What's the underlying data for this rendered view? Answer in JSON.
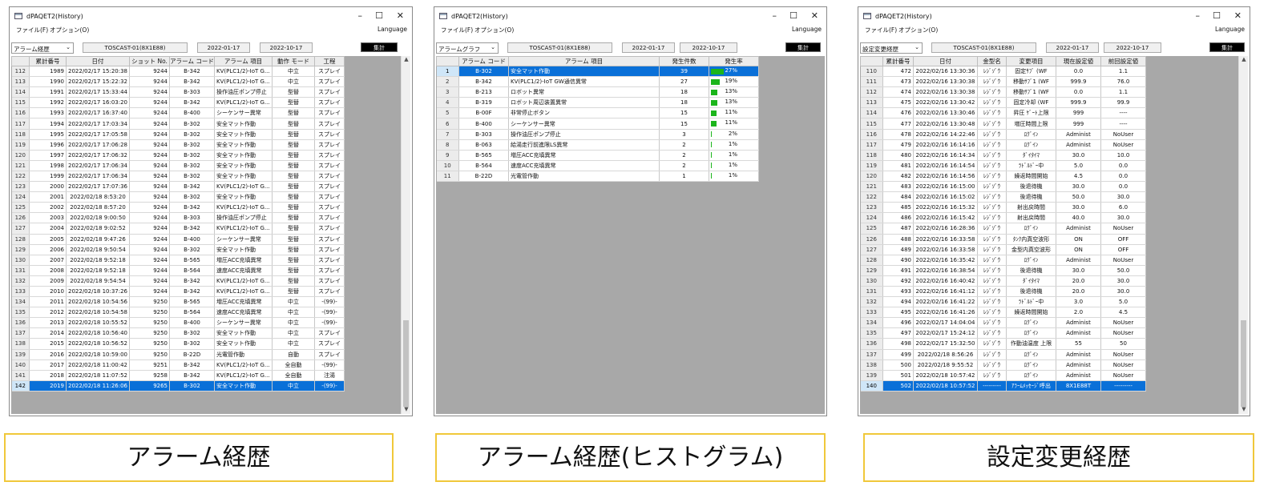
{
  "window_title": "dPAQET2(History)",
  "window_controls": {
    "min": "–",
    "max": "☐",
    "close": "✕"
  },
  "menu": {
    "file": "ファイル(F)",
    "option": "オプション(O)",
    "language": "Language"
  },
  "toolbar": {
    "machine": "TOSCAST-01(8X1E88)",
    "date_from": "2022-01-17",
    "date_to": "2022-10-17",
    "sum_button": "集計"
  },
  "panels": [
    {
      "combo": "アラーム経歴",
      "columns": [
        "累計番号",
        "日付",
        "ショット No.",
        "アラーム コード",
        "アラーム 項目",
        "動作 モード",
        "工程"
      ],
      "rows": [
        [
          "112",
          "1989",
          "2022/02/17 15:20:38",
          "9244",
          "B-342",
          "KV(PLC1/2)-IoT G...",
          "中立",
          "スプレイ"
        ],
        [
          "113",
          "1990",
          "2022/02/17 15:22:32",
          "9244",
          "B-342",
          "KV(PLC1/2)-IoT G...",
          "中立",
          "スプレイ"
        ],
        [
          "114",
          "1991",
          "2022/02/17 15:33:44",
          "9244",
          "B-303",
          "操作油圧ポンプ停止",
          "型替",
          "スプレイ"
        ],
        [
          "115",
          "1992",
          "2022/02/17 16:03:20",
          "9244",
          "B-342",
          "KV(PLC1/2)-IoT G...",
          "型替",
          "スプレイ"
        ],
        [
          "116",
          "1993",
          "2022/02/17 16:37:40",
          "9244",
          "B-400",
          "シーケンサー異常",
          "型替",
          "スプレイ"
        ],
        [
          "117",
          "1994",
          "2022/02/17 17:03:34",
          "9244",
          "B-302",
          "安全マット作動",
          "型替",
          "スプレイ"
        ],
        [
          "118",
          "1995",
          "2022/02/17 17:05:58",
          "9244",
          "B-302",
          "安全マット作動",
          "型替",
          "スプレイ"
        ],
        [
          "119",
          "1996",
          "2022/02/17 17:06:28",
          "9244",
          "B-302",
          "安全マット作動",
          "型替",
          "スプレイ"
        ],
        [
          "120",
          "1997",
          "2022/02/17 17:06:32",
          "9244",
          "B-302",
          "安全マット作動",
          "型替",
          "スプレイ"
        ],
        [
          "121",
          "1998",
          "2022/02/17 17:06:34",
          "9244",
          "B-302",
          "安全マット作動",
          "型替",
          "スプレイ"
        ],
        [
          "122",
          "1999",
          "2022/02/17 17:06:34",
          "9244",
          "B-302",
          "安全マット作動",
          "型替",
          "スプレイ"
        ],
        [
          "123",
          "2000",
          "2022/02/17 17:07:36",
          "9244",
          "B-342",
          "KV(PLC1/2)-IoT G...",
          "型替",
          "スプレイ"
        ],
        [
          "124",
          "2001",
          "2022/02/18 8:53:20",
          "9244",
          "B-302",
          "安全マット作動",
          "型替",
          "スプレイ"
        ],
        [
          "125",
          "2002",
          "2022/02/18 8:57:20",
          "9244",
          "B-342",
          "KV(PLC1/2)-IoT G...",
          "型替",
          "スプレイ"
        ],
        [
          "126",
          "2003",
          "2022/02/18 9:00:50",
          "9244",
          "B-303",
          "操作油圧ポンプ停止",
          "型替",
          "スプレイ"
        ],
        [
          "127",
          "2004",
          "2022/02/18 9:02:52",
          "9244",
          "B-342",
          "KV(PLC1/2)-IoT G...",
          "型替",
          "スプレイ"
        ],
        [
          "128",
          "2005",
          "2022/02/18 9:47:26",
          "9244",
          "B-400",
          "シーケンサー異常",
          "型替",
          "スプレイ"
        ],
        [
          "129",
          "2006",
          "2022/02/18 9:50:54",
          "9244",
          "B-302",
          "安全マット作動",
          "型替",
          "スプレイ"
        ],
        [
          "130",
          "2007",
          "2022/02/18 9:52:18",
          "9244",
          "B-565",
          "増圧ACC充填異常",
          "型替",
          "スプレイ"
        ],
        [
          "131",
          "2008",
          "2022/02/18 9:52:18",
          "9244",
          "B-564",
          "速度ACC充填異常",
          "型替",
          "スプレイ"
        ],
        [
          "132",
          "2009",
          "2022/02/18 9:54:54",
          "9244",
          "B-342",
          "KV(PLC1/2)-IoT G...",
          "型替",
          "スプレイ"
        ],
        [
          "133",
          "2010",
          "2022/02/18 10:37:26",
          "9244",
          "B-342",
          "KV(PLC1/2)-IoT G...",
          "型替",
          "スプレイ"
        ],
        [
          "134",
          "2011",
          "2022/02/18 10:54:56",
          "9250",
          "B-565",
          "増圧ACC充填異常",
          "中立",
          "-(99)-"
        ],
        [
          "135",
          "2012",
          "2022/02/18 10:54:58",
          "9250",
          "B-564",
          "速度ACC充填異常",
          "中立",
          "-(99)-"
        ],
        [
          "136",
          "2013",
          "2022/02/18 10:55:52",
          "9250",
          "B-400",
          "シーケンサー異常",
          "中立",
          "-(99)-"
        ],
        [
          "137",
          "2014",
          "2022/02/18 10:56:40",
          "9250",
          "B-302",
          "安全マット作動",
          "中立",
          "スプレイ"
        ],
        [
          "138",
          "2015",
          "2022/02/18 10:56:52",
          "9250",
          "B-302",
          "安全マット作動",
          "中立",
          "スプレイ"
        ],
        [
          "139",
          "2016",
          "2022/02/18 10:59:00",
          "9250",
          "B-22D",
          "光電管作動",
          "自動",
          "スプレイ"
        ],
        [
          "140",
          "2017",
          "2022/02/18 11:00:42",
          "9251",
          "B-342",
          "KV(PLC1/2)-IoT G...",
          "全自動",
          "-(99)-"
        ],
        [
          "141",
          "2018",
          "2022/02/18 11:07:52",
          "9258",
          "B-342",
          "KV(PLC1/2)-IoT G...",
          "全自動",
          "注湯"
        ],
        [
          "142",
          "2019",
          "2022/02/18 11:26:06",
          "9265",
          "B-302",
          "安全マット作動",
          "中立",
          "-(99)-"
        ]
      ]
    },
    {
      "combo": "アラームグラフ",
      "columns": [
        "アラーム コード",
        "アラーム 項目",
        "発生件数",
        "発生率"
      ],
      "rows": [
        [
          "1",
          "B-302",
          "安全マット作動",
          "39",
          "27%"
        ],
        [
          "2",
          "B-342",
          "KV(PLC1/2)-IoT GW通信異常",
          "27",
          "19%"
        ],
        [
          "3",
          "B-213",
          "ロボット異常",
          "18",
          "13%"
        ],
        [
          "4",
          "B-319",
          "ロボット周辺装置異常",
          "18",
          "13%"
        ],
        [
          "5",
          "B-00F",
          "非常停止ボタン",
          "15",
          "11%"
        ],
        [
          "6",
          "B-400",
          "シーケンサー異常",
          "15",
          "11%"
        ],
        [
          "7",
          "B-303",
          "操作油圧ポンプ停止",
          "3",
          "2%"
        ],
        [
          "8",
          "B-063",
          "給湯走行前進限LS異常",
          "2",
          "1%"
        ],
        [
          "9",
          "B-565",
          "増圧ACC充填異常",
          "2",
          "1%"
        ],
        [
          "10",
          "B-564",
          "速度ACC充填異常",
          "2",
          "1%"
        ],
        [
          "11",
          "B-22D",
          "光電管作動",
          "1",
          "1%"
        ]
      ],
      "rates": [
        0.27,
        0.19,
        0.13,
        0.13,
        0.11,
        0.11,
        0.02,
        0.01,
        0.01,
        0.01,
        0.01
      ]
    },
    {
      "combo": "設定変更経歴",
      "columns": [
        "累計番号",
        "日付",
        "金型名",
        "変更項目",
        "現在設定値",
        "前回設定値"
      ],
      "rows": [
        [
          "110",
          "472",
          "2022/02/16 13:30:36",
          "ﾚｼﾞｿﾞｳ",
          "固定ｻﾌﾞ (WF",
          "0.0",
          "1.1"
        ],
        [
          "111",
          "473",
          "2022/02/16 13:30:38",
          "ﾚｼﾞｿﾞｳ",
          "移動ｻﾌﾞ1 (WF",
          "999.9",
          "76.0"
        ],
        [
          "112",
          "474",
          "2022/02/16 13:30:38",
          "ﾚｼﾞｿﾞｳ",
          "移動ｻﾌﾞ1 (WF",
          "0.0",
          "1.1"
        ],
        [
          "113",
          "475",
          "2022/02/16 13:30:42",
          "ﾚｼﾞｿﾞｳ",
          "固定冷却 (WF",
          "999.9",
          "99.9"
        ],
        [
          "114",
          "476",
          "2022/02/16 13:30:46",
          "ﾚｼﾞｿﾞｳ",
          "昇圧 ｹﾞｰﾄ上限",
          "999",
          "----"
        ],
        [
          "115",
          "477",
          "2022/02/16 13:30:48",
          "ﾚｼﾞｿﾞｳ",
          "増圧時間上限",
          "999",
          "----"
        ],
        [
          "116",
          "478",
          "2022/02/16 14:22:46",
          "ﾚｼﾞｿﾞｳ",
          "ﾛｸﾞｲﾝ",
          "Administ",
          "NoUser"
        ],
        [
          "117",
          "479",
          "2022/02/16 16:14:16",
          "ﾚｼﾞｿﾞｳ",
          "ﾛｸﾞｲﾝ",
          "Administ",
          "NoUser"
        ],
        [
          "118",
          "480",
          "2022/02/16 16:14:34",
          "ﾚｼﾞｿﾞｳ",
          "ﾀﾞｲﾀｲﾏ",
          "30.0",
          "10.0"
        ],
        [
          "119",
          "481",
          "2022/02/16 16:14:54",
          "ﾚｼﾞｿﾞｳ",
          "ﾗﾄﾞﾙﾄﾞｰ中",
          "5.0",
          "0.0"
        ],
        [
          "120",
          "482",
          "2022/02/16 16:14:56",
          "ﾚｼﾞｿﾞｳ",
          "繰返時間開始",
          "4.5",
          "0.0"
        ],
        [
          "121",
          "483",
          "2022/02/16 16:15:00",
          "ﾚｼﾞｿﾞｳ",
          "後退待機",
          "30.0",
          "0.0"
        ],
        [
          "122",
          "484",
          "2022/02/16 16:15:02",
          "ﾚｼﾞｿﾞｳ",
          "後退待機",
          "50.0",
          "30.0"
        ],
        [
          "123",
          "485",
          "2022/02/16 16:15:32",
          "ﾚｼﾞｿﾞｳ",
          "射出戻時間",
          "30.0",
          "6.0"
        ],
        [
          "124",
          "486",
          "2022/02/16 16:15:42",
          "ﾚｼﾞｿﾞｳ",
          "射出戻時間",
          "40.0",
          "30.0"
        ],
        [
          "125",
          "487",
          "2022/02/16 16:28:36",
          "ﾚｼﾞｿﾞｳ",
          "ﾛｸﾞｲﾝ",
          "Administ",
          "NoUser"
        ],
        [
          "126",
          "488",
          "2022/02/16 16:33:58",
          "ﾚｼﾞｿﾞｳ",
          "ﾀﾝｸ内真空波形",
          "ON",
          "OFF"
        ],
        [
          "127",
          "489",
          "2022/02/16 16:33:58",
          "ﾚｼﾞｿﾞｳ",
          "金型内真空波形",
          "ON",
          "OFF"
        ],
        [
          "128",
          "490",
          "2022/02/16 16:35:42",
          "ﾚｼﾞｿﾞｳ",
          "ﾛｸﾞｲﾝ",
          "Administ",
          "NoUser"
        ],
        [
          "129",
          "491",
          "2022/02/16 16:38:54",
          "ﾚｼﾞｿﾞｳ",
          "後退待機",
          "30.0",
          "50.0"
        ],
        [
          "130",
          "492",
          "2022/02/16 16:40:42",
          "ﾚｼﾞｿﾞｳ",
          "ﾀﾞｲﾀｲﾏ",
          "20.0",
          "30.0"
        ],
        [
          "131",
          "493",
          "2022/02/16 16:41:12",
          "ﾚｼﾞｿﾞｳ",
          "後退待機",
          "20.0",
          "30.0"
        ],
        [
          "132",
          "494",
          "2022/02/16 16:41:22",
          "ﾚｼﾞｿﾞｳ",
          "ﾗﾄﾞﾙﾄﾞｰ中",
          "3.0",
          "5.0"
        ],
        [
          "133",
          "495",
          "2022/02/16 16:41:26",
          "ﾚｼﾞｿﾞｳ",
          "繰返時間開始",
          "2.0",
          "4.5"
        ],
        [
          "134",
          "496",
          "2022/02/17 14:04:04",
          "ﾚｼﾞｿﾞｳ",
          "ﾛｸﾞｲﾝ",
          "Administ",
          "NoUser"
        ],
        [
          "135",
          "497",
          "2022/02/17 15:24:12",
          "ﾚｼﾞｿﾞｳ",
          "ﾛｸﾞｲﾝ",
          "Administ",
          "NoUser"
        ],
        [
          "136",
          "498",
          "2022/02/17 15:32:50",
          "ﾚｼﾞｿﾞｳ",
          "作動油温度 上限",
          "55",
          "50"
        ],
        [
          "137",
          "499",
          "2022/02/18 8:56:26",
          "ﾚｼﾞｿﾞｳ",
          "ﾛｸﾞｲﾝ",
          "Administ",
          "NoUser"
        ],
        [
          "138",
          "500",
          "2022/02/18 9:55:52",
          "ﾚｼﾞｿﾞｳ",
          "ﾛｸﾞｲﾝ",
          "Administ",
          "NoUser"
        ],
        [
          "139",
          "501",
          "2022/02/18 10:57:42",
          "ﾚｼﾞｿﾞｳ",
          "ﾛｸﾞｲﾝ",
          "Administ",
          "NoUser"
        ],
        [
          "140",
          "502",
          "2022/02/18 10:57:52",
          "---------",
          "ｱﾗｰﾑﾒｯｾｰｼﾞ呼出",
          "8X1E88T",
          "---------"
        ]
      ]
    }
  ],
  "captions": [
    "アラーム経歴",
    "アラーム経歴(ヒストグラム)",
    "設定変更経歴"
  ],
  "colors": {
    "selection": "#0a70d8",
    "bar": "#1bb51b",
    "caption_border": "#f0c83a"
  }
}
